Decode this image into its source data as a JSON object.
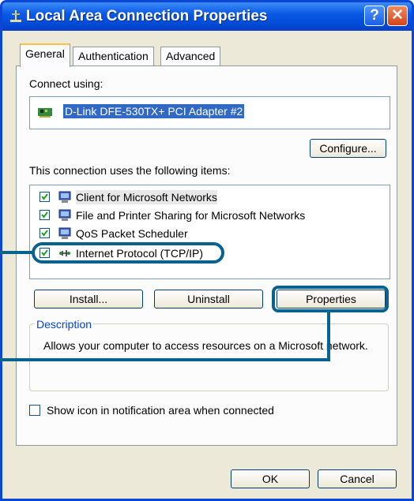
{
  "window": {
    "title": "Local Area Connection Properties",
    "help_label": "?",
    "close_label": "✕"
  },
  "tabs": [
    {
      "label": "General",
      "active": true
    },
    {
      "label": "Authentication",
      "active": false
    },
    {
      "label": "Advanced",
      "active": false
    }
  ],
  "connect_using": {
    "label": "Connect using:",
    "adapter": "D-Link DFE-530TX+ PCI Adapter #2",
    "adapter_icon": "network-card-icon"
  },
  "buttons": {
    "configure": "Configure...",
    "install": "Install...",
    "uninstall": "Uninstall",
    "properties": "Properties",
    "ok": "OK",
    "cancel": "Cancel"
  },
  "items_label": "This connection uses the following items:",
  "items": [
    {
      "label": "Client for Microsoft Networks",
      "checked": true,
      "icon": "computer-icon"
    },
    {
      "label": "File and Printer Sharing for Microsoft Networks",
      "checked": true,
      "icon": "computer-icon"
    },
    {
      "label": "QoS Packet Scheduler",
      "checked": true,
      "icon": "computer-icon"
    },
    {
      "label": "Internet Protocol (TCP/IP)",
      "checked": true,
      "icon": "protocol-icon"
    }
  ],
  "description": {
    "title": "Description",
    "text": "Allows your computer to access resources on a Microsoft network."
  },
  "notify_checkbox": {
    "label": "Show icon in notification area when connected",
    "checked": false
  },
  "colors": {
    "titlebar": "#0a5ae6",
    "highlight": "#07628d",
    "face": "#ece9d8"
  }
}
